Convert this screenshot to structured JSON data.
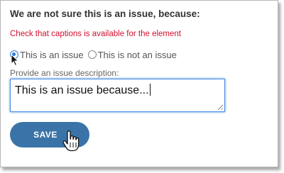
{
  "dialog": {
    "heading": "We are not sure this is an issue, because:",
    "error_message": "Check that captions is available for the element",
    "options": [
      {
        "label": "This is an issue",
        "selected": true
      },
      {
        "label": "This is not an issue",
        "selected": false
      }
    ],
    "description_label": "Provide an issue description:",
    "description_value": "This is an issue because...",
    "save_label": "SAVE"
  },
  "icons": {
    "pointer": "arrow-cursor-icon",
    "hand": "hand-cursor-icon",
    "grip": "resize-grip-icon"
  },
  "colors": {
    "error": "#d0102e",
    "accent": "#2f78d6",
    "button": "#3a73a8"
  }
}
